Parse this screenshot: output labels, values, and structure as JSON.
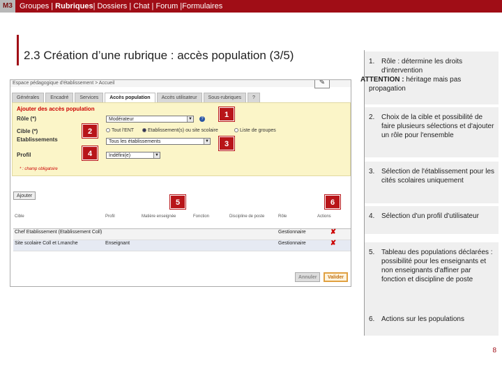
{
  "topbar": {
    "badge": "M3",
    "nav_1": "Groupes | ",
    "nav_2": "Rubriques",
    "nav_3": "| Dossiers | Chat | Forum |Formulaires"
  },
  "slide_title": "2.3 Création d’une rubrique : accès population (3/5)",
  "screenshot": {
    "breadcrumb": "Espace pédagogique d'établissement  >  Accueil",
    "pencil": "✎",
    "tabs": [
      "Générales",
      "Encadré",
      "Services",
      "Accès population",
      "Accès utilisateur",
      "Sous-rubriques",
      "?"
    ],
    "form_legend": "Ajouter des accès population",
    "role_label": "Rôle (*)",
    "role_value": "Modérateur",
    "cible_label": "Cible (*)",
    "cible_opt1": "Tout l'ENT",
    "cible_opt2": "Etablissement(s) ou site scolaire",
    "cible_opt3": "Liste de groupes",
    "etab_label": "Etablissements",
    "etab_value": "Tous les établissements",
    "profil_label": "Profil",
    "profil_value": "Indéfini(e)",
    "required_note": "* : champ obligatoire",
    "add_button": "Ajouter",
    "table_headers": [
      "Cible",
      "Profil",
      "Matière enseignée",
      "Fonction",
      "Discipline de poste",
      "Rôle",
      "Actions"
    ],
    "rows": [
      {
        "cible": "Chef Etablissement (Etablissement Coll)",
        "profil": "",
        "matiere": "",
        "fonction": "",
        "discipline": "",
        "role": "Gestionnaire"
      },
      {
        "cible": "Site scolaire Coll et Lmanche",
        "profil": "Enseignant",
        "matiere": "",
        "fonction": "",
        "discipline": "",
        "role": "Gestionnaire"
      }
    ],
    "delete_icon": "✘",
    "cancel_button": "Annuler",
    "validate_button": "Valider"
  },
  "callouts": [
    "1",
    "2",
    "3",
    "4",
    "5",
    "6"
  ],
  "items": [
    {
      "num": "1.",
      "text": "Rôle : détermine les droits d'intervention",
      "attention_label": "ATTENTION :",
      "attention_text": "héritage mais pas propagation"
    },
    {
      "num": "2.",
      "text": "Choix de la cible et possibilité de faire plusieurs sélections et d'ajouter un rôle pour l'ensemble"
    },
    {
      "num": "3.",
      "text": "Sélection de l'établissement pour les cités scolaires uniquement"
    },
    {
      "num": "4.",
      "text": "Sélection d'un profil d'utilisateur"
    },
    {
      "num": "5.",
      "text": "Tableau des populations déclarées : possibilité pour les enseignants et non enseignants d'affiner par fonction et discipline de poste"
    },
    {
      "num": "6.",
      "text": "Actions sur les populations"
    }
  ],
  "page_number": "8",
  "colors": {
    "brand_red": "#a00d16",
    "callout_red": "#b81519",
    "form_yellow": "#fbf5c8"
  }
}
